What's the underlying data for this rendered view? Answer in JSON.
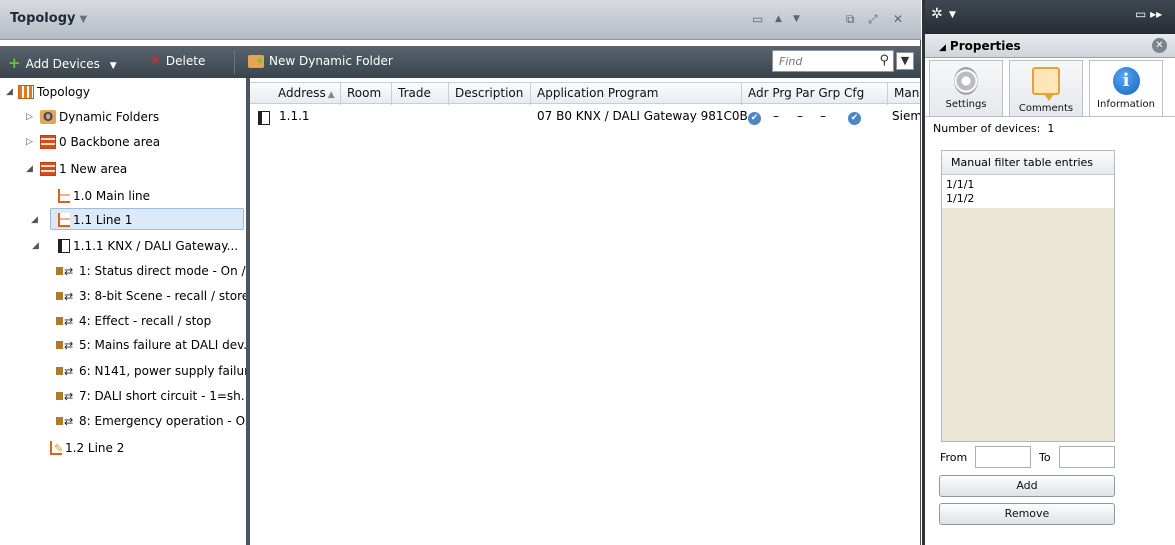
{
  "topology": {
    "title": "Topology",
    "toolbar": {
      "add_devices": "Add Devices",
      "delete": "Delete",
      "new_dynamic_folder": "New Dynamic Folder",
      "find_placeholder": "Find"
    },
    "tree": [
      {
        "label": "Topology",
        "icon": "topology-icon"
      },
      {
        "label": "Dynamic Folders",
        "icon": "dynamic-folder-icon"
      },
      {
        "label": "0 Backbone area",
        "icon": "area-icon"
      },
      {
        "label": "1 New area",
        "icon": "area-icon"
      },
      {
        "label": "1.0 Main line",
        "icon": "line-icon"
      },
      {
        "label": "1.1 Line 1",
        "icon": "line-icon"
      },
      {
        "label": "1.1.1  KNX / DALI Gateway...",
        "icon": "device-icon"
      },
      {
        "label": "1: Status direct mode - On /...",
        "icon": "group-object-icon"
      },
      {
        "label": "3: 8-bit Scene - recall / store",
        "icon": "group-object-icon"
      },
      {
        "label": "4: Effect - recall / stop",
        "icon": "group-object-icon"
      },
      {
        "label": "5: Mains failure at DALI dev...",
        "icon": "group-object-icon"
      },
      {
        "label": "6: N141, power supply failur...",
        "icon": "group-object-icon"
      },
      {
        "label": "7: DALI short circuit - 1=sh...",
        "icon": "group-object-icon"
      },
      {
        "label": "8: Emergency operation - O...",
        "icon": "group-object-icon"
      },
      {
        "label": "1.2 Line 2",
        "icon": "line-edit-icon"
      }
    ],
    "table": {
      "columns": [
        "Address",
        "Room",
        "Trade",
        "Description",
        "Application Program",
        "Adr Prg Par Grp Cfg",
        "Man"
      ],
      "rows": [
        {
          "address": "1.1.1",
          "room": "",
          "trade": "",
          "description": "",
          "application_program": "07 B0 KNX / DALI Gateway 981C0B",
          "adr": "✔",
          "prg": "–",
          "par": "–",
          "grp": "–",
          "cfg": "✔",
          "manufacturer": "Siem"
        }
      ]
    }
  },
  "properties": {
    "title": "Properties",
    "tabs": [
      "Settings",
      "Comments",
      "Information"
    ],
    "active_tab": "Information",
    "number_of_devices_label": "Number of devices:",
    "number_of_devices": "1",
    "filter_table_header": "Manual filter table entries",
    "filter_entries": [
      "1/1/1",
      "1/1/2"
    ],
    "from_label": "From",
    "to_label": "To",
    "from_value": "",
    "to_value": "",
    "add_button": "Add",
    "remove_button": "Remove"
  }
}
